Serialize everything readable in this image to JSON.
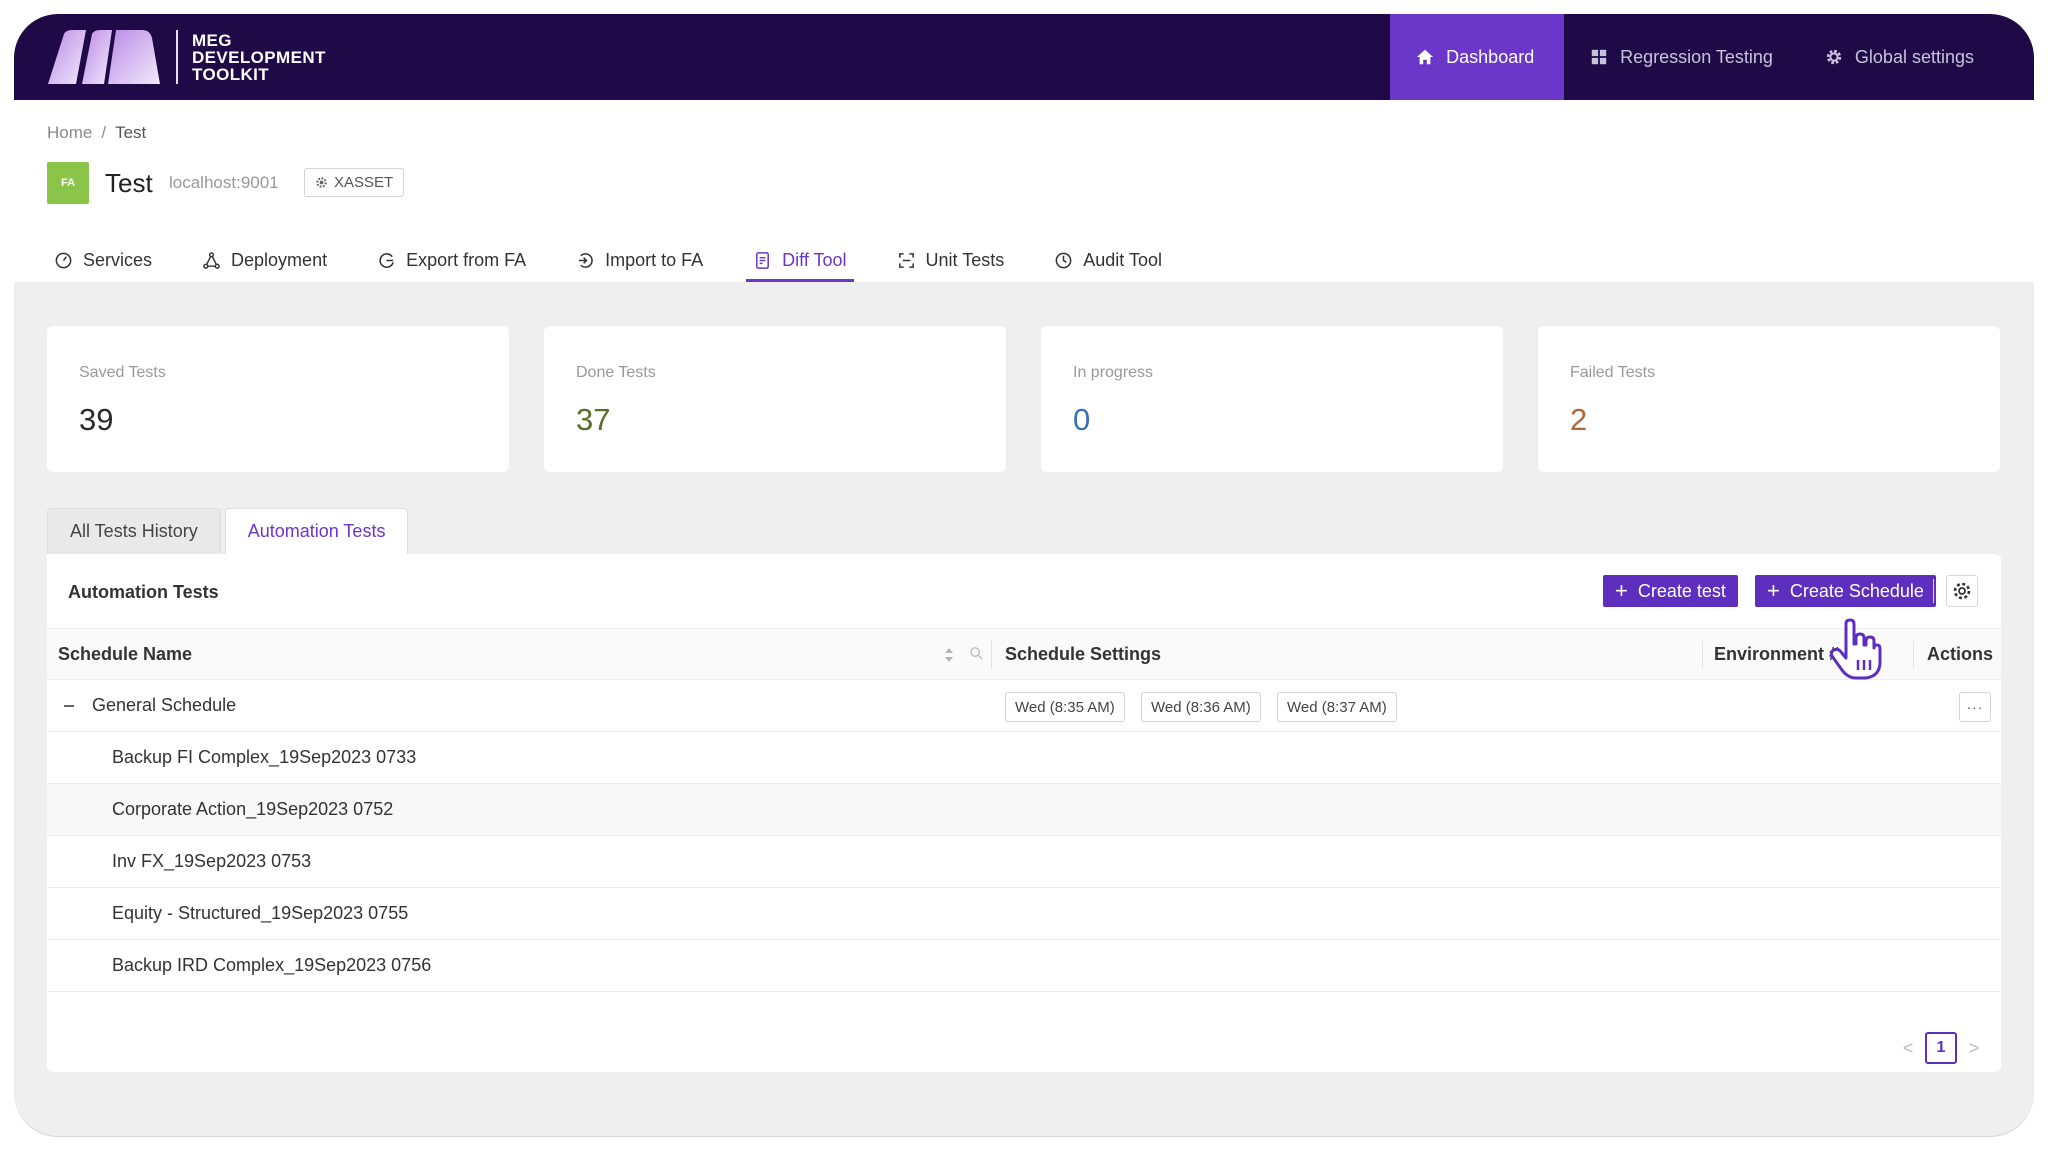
{
  "app": {
    "logo_lines": [
      "MEG",
      "DEVELOPMENT",
      "TOOLKIT"
    ]
  },
  "nav": {
    "items": [
      {
        "label": "Dashboard",
        "icon": "home-icon",
        "active": true
      },
      {
        "label": "Regression Testing",
        "icon": "grid-icon",
        "active": false
      },
      {
        "label": "Global settings",
        "icon": "gear-icon",
        "active": false
      }
    ]
  },
  "breadcrumb": [
    "Home",
    "/",
    "Test"
  ],
  "project": {
    "badge": "FA",
    "title": "Test",
    "host": "localhost:9001",
    "tag": "XASSET"
  },
  "tabs": [
    {
      "label": "Services",
      "icon": "dashboard-gauge-icon"
    },
    {
      "label": "Deployment",
      "icon": "deployment-icon"
    },
    {
      "label": "Export from FA",
      "icon": "export-icon"
    },
    {
      "label": "Import to FA",
      "icon": "import-icon"
    },
    {
      "label": "Diff Tool",
      "icon": "diff-document-icon",
      "active": true
    },
    {
      "label": "Unit Tests",
      "icon": "unit-test-icon"
    },
    {
      "label": "Audit Tool",
      "icon": "clock-icon"
    }
  ],
  "stats": [
    {
      "label": "Saved Tests",
      "value": "39",
      "color": "#2b2b2b"
    },
    {
      "label": "Done Tests",
      "value": "37",
      "color": "#5a6d2f"
    },
    {
      "label": "In progress",
      "value": "0",
      "color": "#3b6fb6"
    },
    {
      "label": "Failed Tests",
      "value": "2",
      "color": "#b0653a"
    }
  ],
  "subtabs": [
    "All Tests History",
    "Automation Tests"
  ],
  "panel": {
    "title": "Automation Tests",
    "create_test": "Create test",
    "create_schedule": "Create Schedule"
  },
  "table": {
    "columns": [
      "Schedule Name",
      "Schedule Settings",
      "Environment #",
      "Actions"
    ],
    "group": {
      "name": "General Schedule",
      "times": [
        "Wed (8:35 AM)",
        "Wed (8:36 AM)",
        "Wed (8:37 AM)"
      ],
      "actions": "···"
    },
    "rows": [
      "Backup FI Complex_19Sep2023 0733",
      "Corporate Action_19Sep2023 0752",
      "Inv FX_19Sep2023 0753",
      "Equity - Structured_19Sep2023 0755",
      "Backup IRD Complex_19Sep2023 0756"
    ]
  },
  "pagination": {
    "prev": "<",
    "current": "1",
    "next": ">"
  },
  "colors": {
    "nav_bg": "#1f0a47",
    "accent": "#6a37c9",
    "button": "#5e2fbf"
  }
}
